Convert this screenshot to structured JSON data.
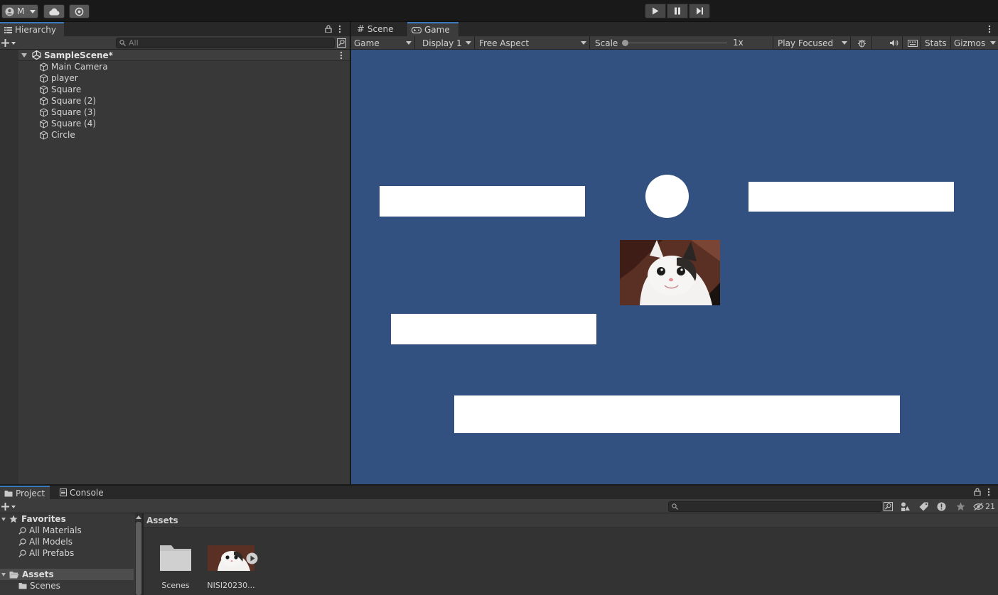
{
  "toolbar": {
    "account_label": "M",
    "play_icon": "play-icon",
    "pause_icon": "pause-icon",
    "step_icon": "step-icon"
  },
  "hierarchy": {
    "tab_label": "Hierarchy",
    "search_placeholder": "All",
    "scene_name": "SampleScene*",
    "items": [
      "Main Camera",
      "player",
      "Square",
      "Square (2)",
      "Square (3)",
      "Square (4)",
      "Circle"
    ]
  },
  "viewport": {
    "tabs": [
      {
        "label": "Scene"
      },
      {
        "label": "Game"
      }
    ],
    "game_dropdown": "Game",
    "display_dropdown": "Display 1",
    "aspect_dropdown": "Free Aspect",
    "scale_label": "Scale",
    "scale_value": "1x",
    "play_mode_dropdown": "Play Focused",
    "stats_label": "Stats",
    "gizmos_label": "Gizmos",
    "background_color": "#325180"
  },
  "project": {
    "tabs": [
      {
        "label": "Project"
      },
      {
        "label": "Console"
      }
    ],
    "favorites_label": "Favorites",
    "favorites": [
      "All Materials",
      "All Models",
      "All Prefabs"
    ],
    "assets_tree_label": "Assets",
    "assets_tree_children": [
      "Scenes"
    ],
    "breadcrumb": "Assets",
    "hidden_count": "21",
    "asset_items": [
      {
        "label": "Scenes"
      },
      {
        "label": "NISI20230..."
      }
    ]
  }
}
